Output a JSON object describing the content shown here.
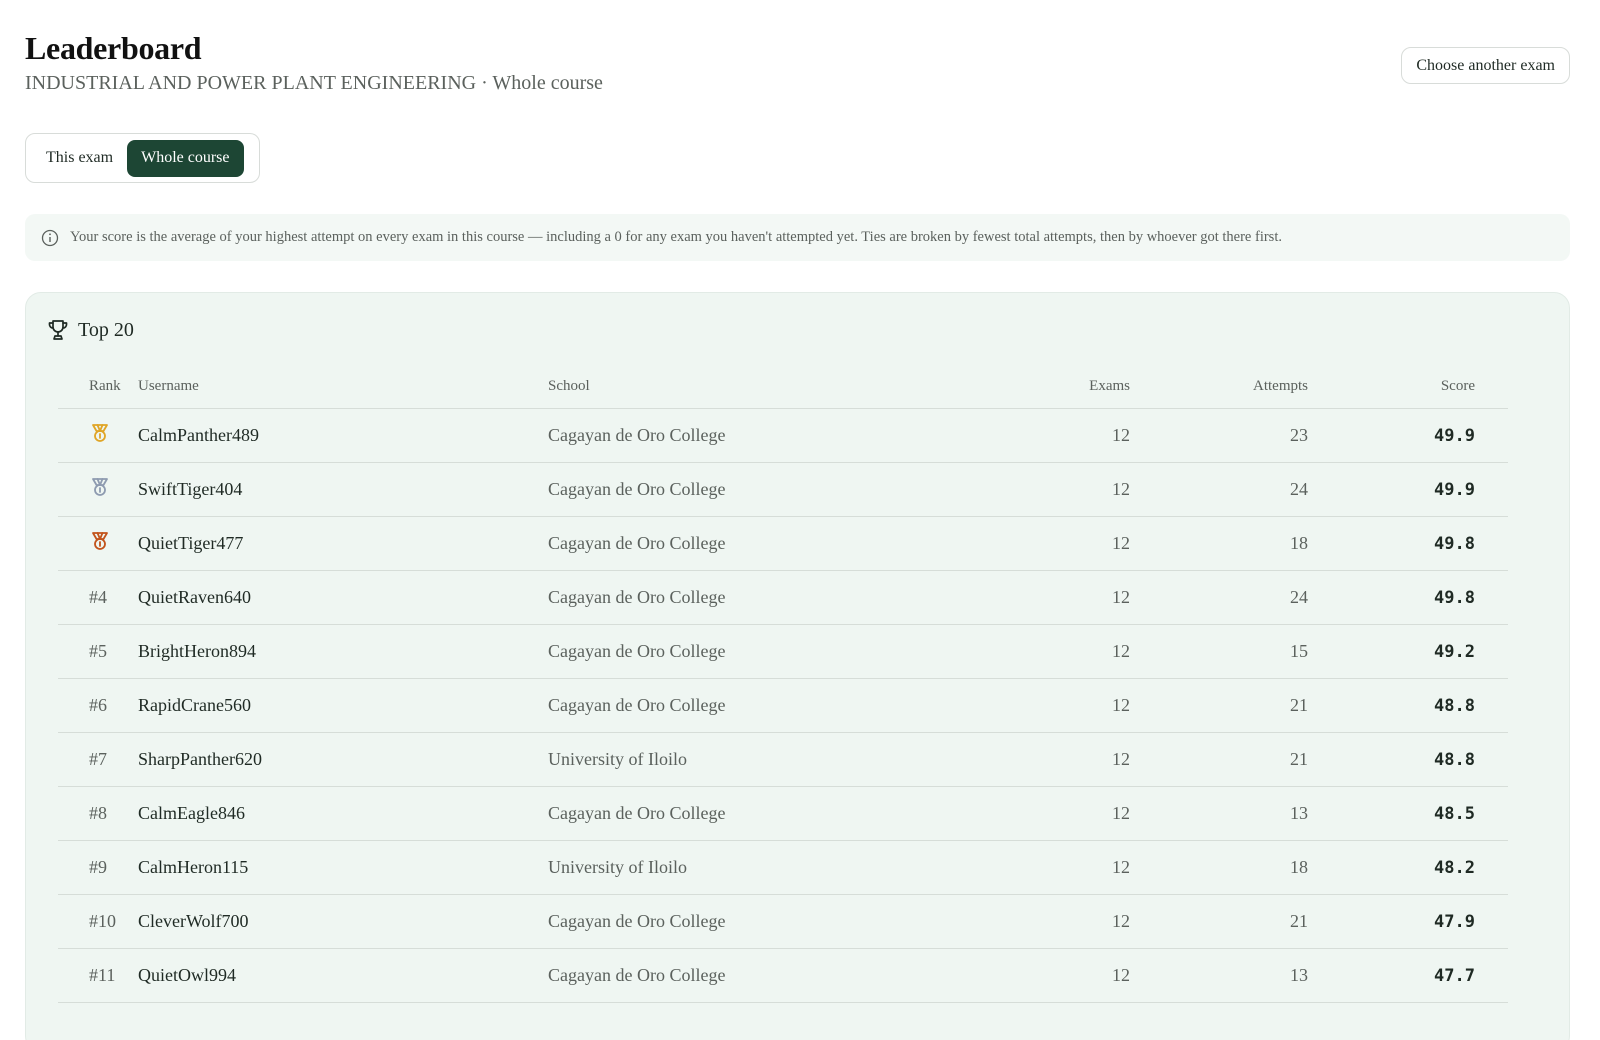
{
  "header": {
    "title": "Leaderboard",
    "subtitle": "INDUSTRIAL AND POWER PLANT ENGINEERING · Whole course",
    "choose_label": "Choose another exam"
  },
  "toggle": {
    "this_exam": "This exam",
    "whole_course": "Whole course",
    "selected": "whole_course"
  },
  "info": {
    "text": "Your score is the average of your highest attempt on every exam in this course — including a 0 for any exam you haven't attempted yet. Ties are broken by fewest total attempts, then by whoever got there first."
  },
  "leaderboard": {
    "heading": "Top 20",
    "columns": {
      "rank": "Rank",
      "username": "Username",
      "school": "School",
      "exams": "Exams",
      "attempts": "Attempts",
      "score": "Score"
    },
    "rows": [
      {
        "rank": "",
        "medal": "gold",
        "username": "CalmPanther489",
        "school": "Cagayan de Oro College",
        "exams": "12",
        "attempts": "23",
        "score": "49.9"
      },
      {
        "rank": "",
        "medal": "silver",
        "username": "SwiftTiger404",
        "school": "Cagayan de Oro College",
        "exams": "12",
        "attempts": "24",
        "score": "49.9"
      },
      {
        "rank": "",
        "medal": "bronze",
        "username": "QuietTiger477",
        "school": "Cagayan de Oro College",
        "exams": "12",
        "attempts": "18",
        "score": "49.8"
      },
      {
        "rank": "#4",
        "username": "QuietRaven640",
        "school": "Cagayan de Oro College",
        "exams": "12",
        "attempts": "24",
        "score": "49.8"
      },
      {
        "rank": "#5",
        "username": "BrightHeron894",
        "school": "Cagayan de Oro College",
        "exams": "12",
        "attempts": "15",
        "score": "49.2"
      },
      {
        "rank": "#6",
        "username": "RapidCrane560",
        "school": "Cagayan de Oro College",
        "exams": "12",
        "attempts": "21",
        "score": "48.8"
      },
      {
        "rank": "#7",
        "username": "SharpPanther620",
        "school": "University of Iloilo",
        "exams": "12",
        "attempts": "21",
        "score": "48.8"
      },
      {
        "rank": "#8",
        "username": "CalmEagle846",
        "school": "Cagayan de Oro College",
        "exams": "12",
        "attempts": "13",
        "score": "48.5"
      },
      {
        "rank": "#9",
        "username": "CalmHeron115",
        "school": "University of Iloilo",
        "exams": "12",
        "attempts": "18",
        "score": "48.2"
      },
      {
        "rank": "#10",
        "username": "CleverWolf700",
        "school": "Cagayan de Oro College",
        "exams": "12",
        "attempts": "21",
        "score": "47.9"
      },
      {
        "rank": "#11",
        "username": "QuietOwl994",
        "school": "Cagayan de Oro College",
        "exams": "12",
        "attempts": "13",
        "score": "47.7"
      }
    ]
  },
  "colors": {
    "accent": "#1d4634",
    "gold": "#e0a526",
    "silver": "#8e9bb0",
    "bronze": "#c2531b"
  }
}
